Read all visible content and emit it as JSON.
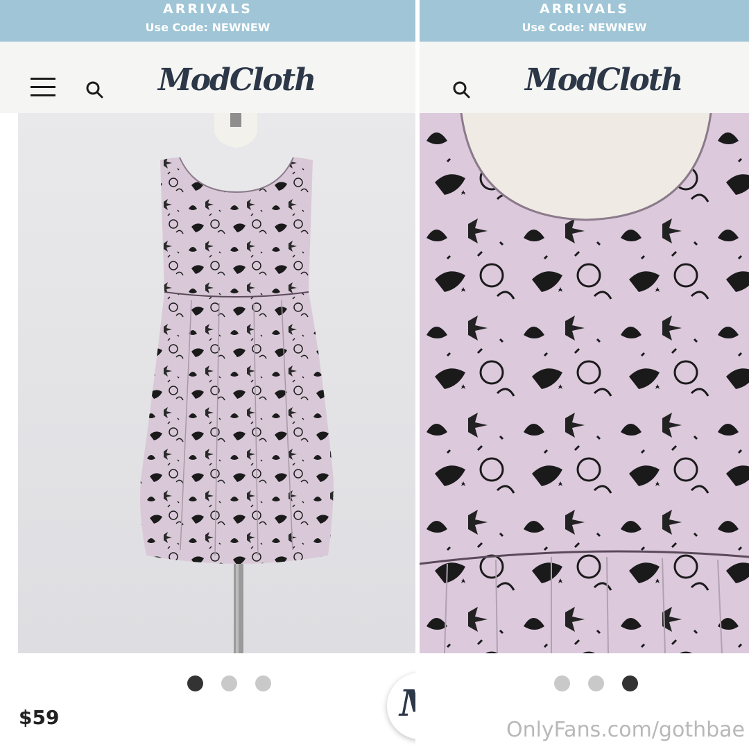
{
  "promo": {
    "heading": "ARRIVALS",
    "code_text": "Use Code: NEWNEW"
  },
  "header": {
    "logo": "ModCloth",
    "menu_icon": "hamburger-menu-icon",
    "search_icon": "search-icon"
  },
  "product": {
    "price": "$59",
    "gallery": {
      "left": {
        "active_index": 0,
        "count": 3
      },
      "right": {
        "active_index": 2,
        "count": 3
      }
    }
  },
  "fab": {
    "letter": "M"
  },
  "watermark": "OnlyFans.com/gothbae",
  "colors": {
    "promo_bar": "#9fc5d6",
    "logo": "#2c3748",
    "dress": "#d8c8d8",
    "print": "#1a1a1a"
  }
}
